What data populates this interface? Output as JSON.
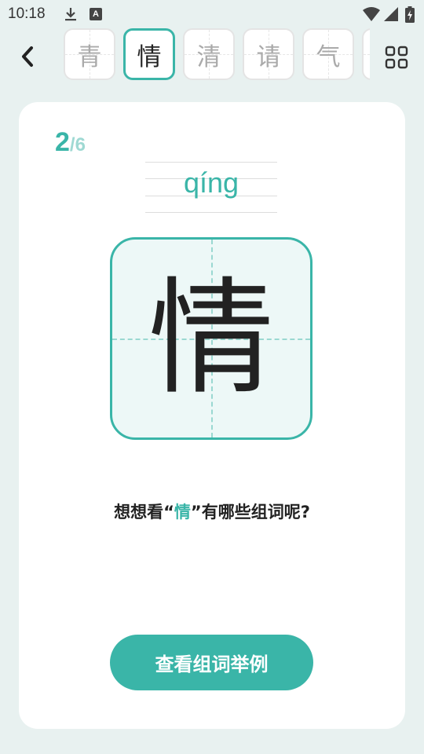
{
  "status_bar": {
    "time": "10:18",
    "icons": [
      "download-icon",
      "a-icon",
      "wifi-icon",
      "signal-icon",
      "battery-icon"
    ],
    "a_icon_text": "A"
  },
  "header": {
    "back_icon": "chevron-left-icon",
    "tabs": [
      {
        "char": "青",
        "active": false
      },
      {
        "char": "情",
        "active": true
      },
      {
        "char": "清",
        "active": false
      },
      {
        "char": "请",
        "active": false
      },
      {
        "char": "气",
        "active": false
      }
    ],
    "grid_icon": "grid-icon"
  },
  "card": {
    "progress_current": "2",
    "progress_total": "/6",
    "pinyin": "qíng",
    "character": "情",
    "question_prefix": "想想看“",
    "question_char": "情",
    "question_suffix": "”有哪些组词呢?",
    "button_label": "查看组词举例"
  },
  "colors": {
    "accent": "#3ab5a8",
    "accent_light": "#9fd9d3",
    "background": "#e8f1f0",
    "card": "#ffffff",
    "char_box_fill": "#edf8f7"
  }
}
